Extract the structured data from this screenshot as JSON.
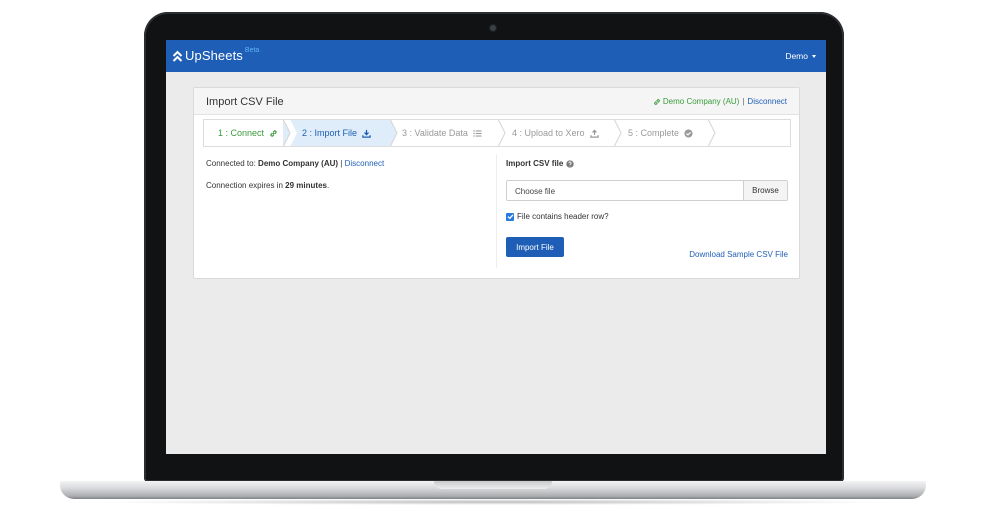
{
  "navbar": {
    "brand": "UpSheets",
    "badge": "Beta",
    "user_menu": "Demo"
  },
  "panel": {
    "title": "Import CSV File",
    "company_link": "Demo Company (AU)",
    "separator": "|",
    "disconnect": "Disconnect"
  },
  "steps": [
    {
      "label": "1 : Connect",
      "icon": "link-icon",
      "state": "completed"
    },
    {
      "label": "2 : Import File",
      "icon": "download-icon",
      "state": "active"
    },
    {
      "label": "3 : Validate Data",
      "icon": "list-icon",
      "state": "pending"
    },
    {
      "label": "4 : Upload to Xero",
      "icon": "upload-icon",
      "state": "pending"
    },
    {
      "label": "5 : Complete",
      "icon": "check-circle-icon",
      "state": "pending"
    }
  ],
  "connection": {
    "connected_prefix": "Connected to:",
    "company": "Demo Company (AU)",
    "separator": "|",
    "disconnect": "Disconnect",
    "expires_prefix": "Connection expires in",
    "expires_value": "29 minutes",
    "expires_suffix": "."
  },
  "import_form": {
    "label": "Import CSV file",
    "file_placeholder": "Choose file",
    "browse": "Browse",
    "header_row_label": "File contains header row?",
    "header_row_checked": true,
    "submit": "Import File",
    "sample_link": "Download Sample CSV File"
  },
  "colors": {
    "brand": "#1f5eb6",
    "completed": "#3a9b3a",
    "active_bg": "#deedf9",
    "pending": "#999999"
  }
}
